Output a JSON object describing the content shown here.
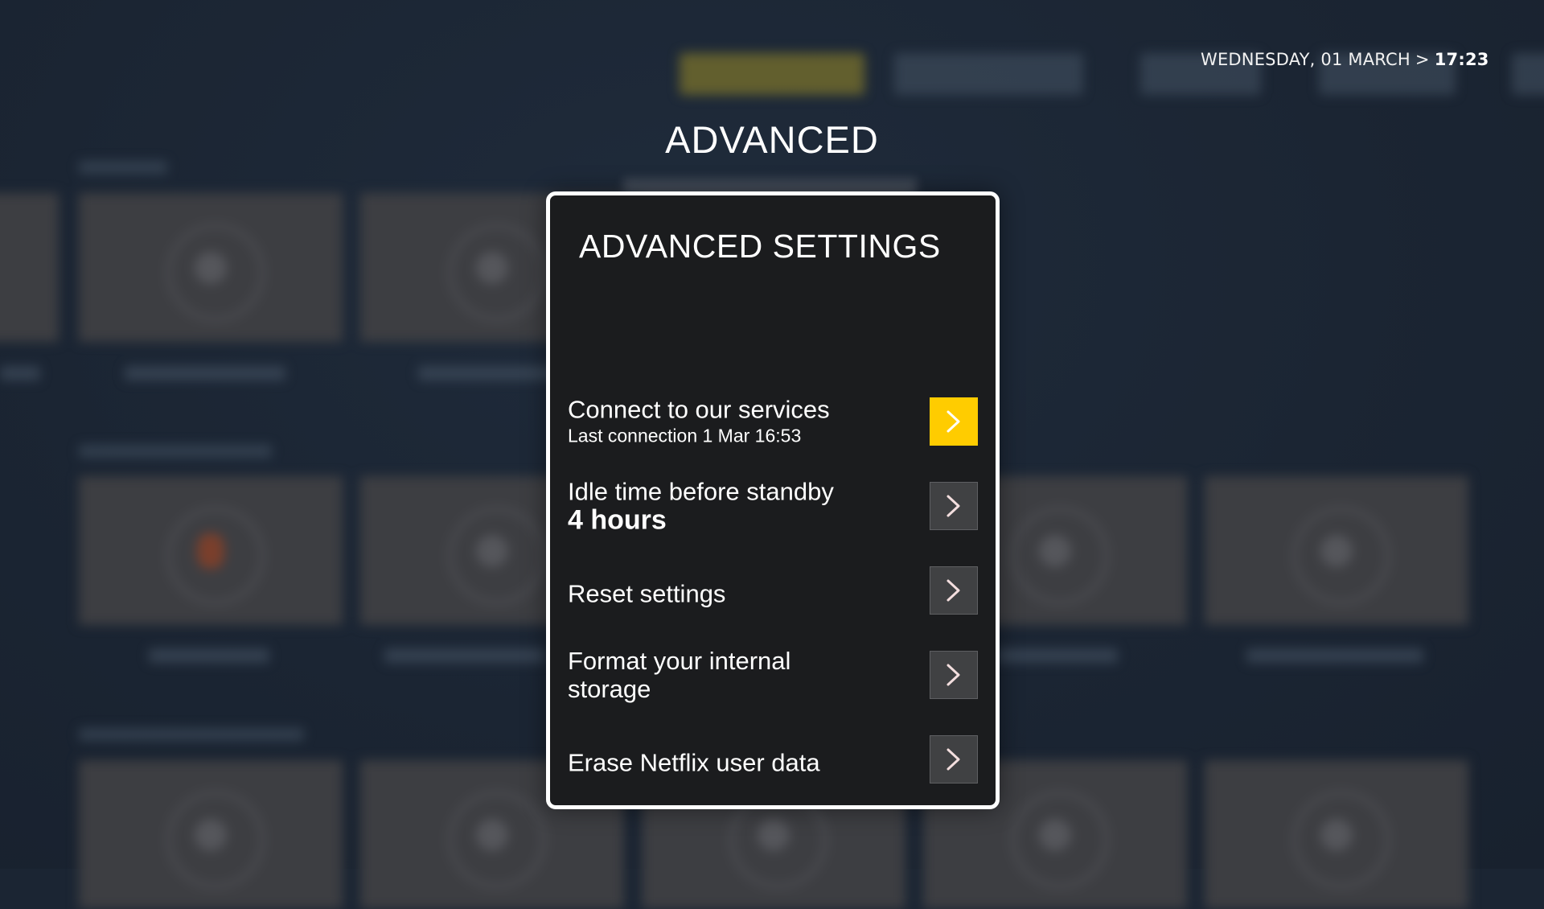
{
  "header": {
    "date": "WEDNESDAY, 01 MARCH",
    "separator": ">",
    "time": "17:23",
    "page_title": "ADVANCED"
  },
  "dialog": {
    "title": "ADVANCED SETTINGS",
    "items": [
      {
        "label": "Connect to our services",
        "subtitle": "Last connection 1 Mar 16:53",
        "icon": "chevron-right-icon",
        "focused": true
      },
      {
        "label": "Idle time before standby",
        "value": "4 hours",
        "icon": "chevron-right-icon",
        "focused": false
      },
      {
        "label": "Reset settings",
        "icon": "chevron-right-icon",
        "focused": false
      },
      {
        "label": "Format your internal storage",
        "icon": "chevron-right-icon",
        "focused": false
      },
      {
        "label": "Erase Netflix user data",
        "icon": "chevron-right-icon",
        "focused": false
      }
    ]
  },
  "colors": {
    "background": "#1b2533",
    "dialog_bg": "#1b1c1e",
    "dialog_border": "#ffffff",
    "focus_accent": "#ffcc00",
    "button_bg": "#404143"
  }
}
